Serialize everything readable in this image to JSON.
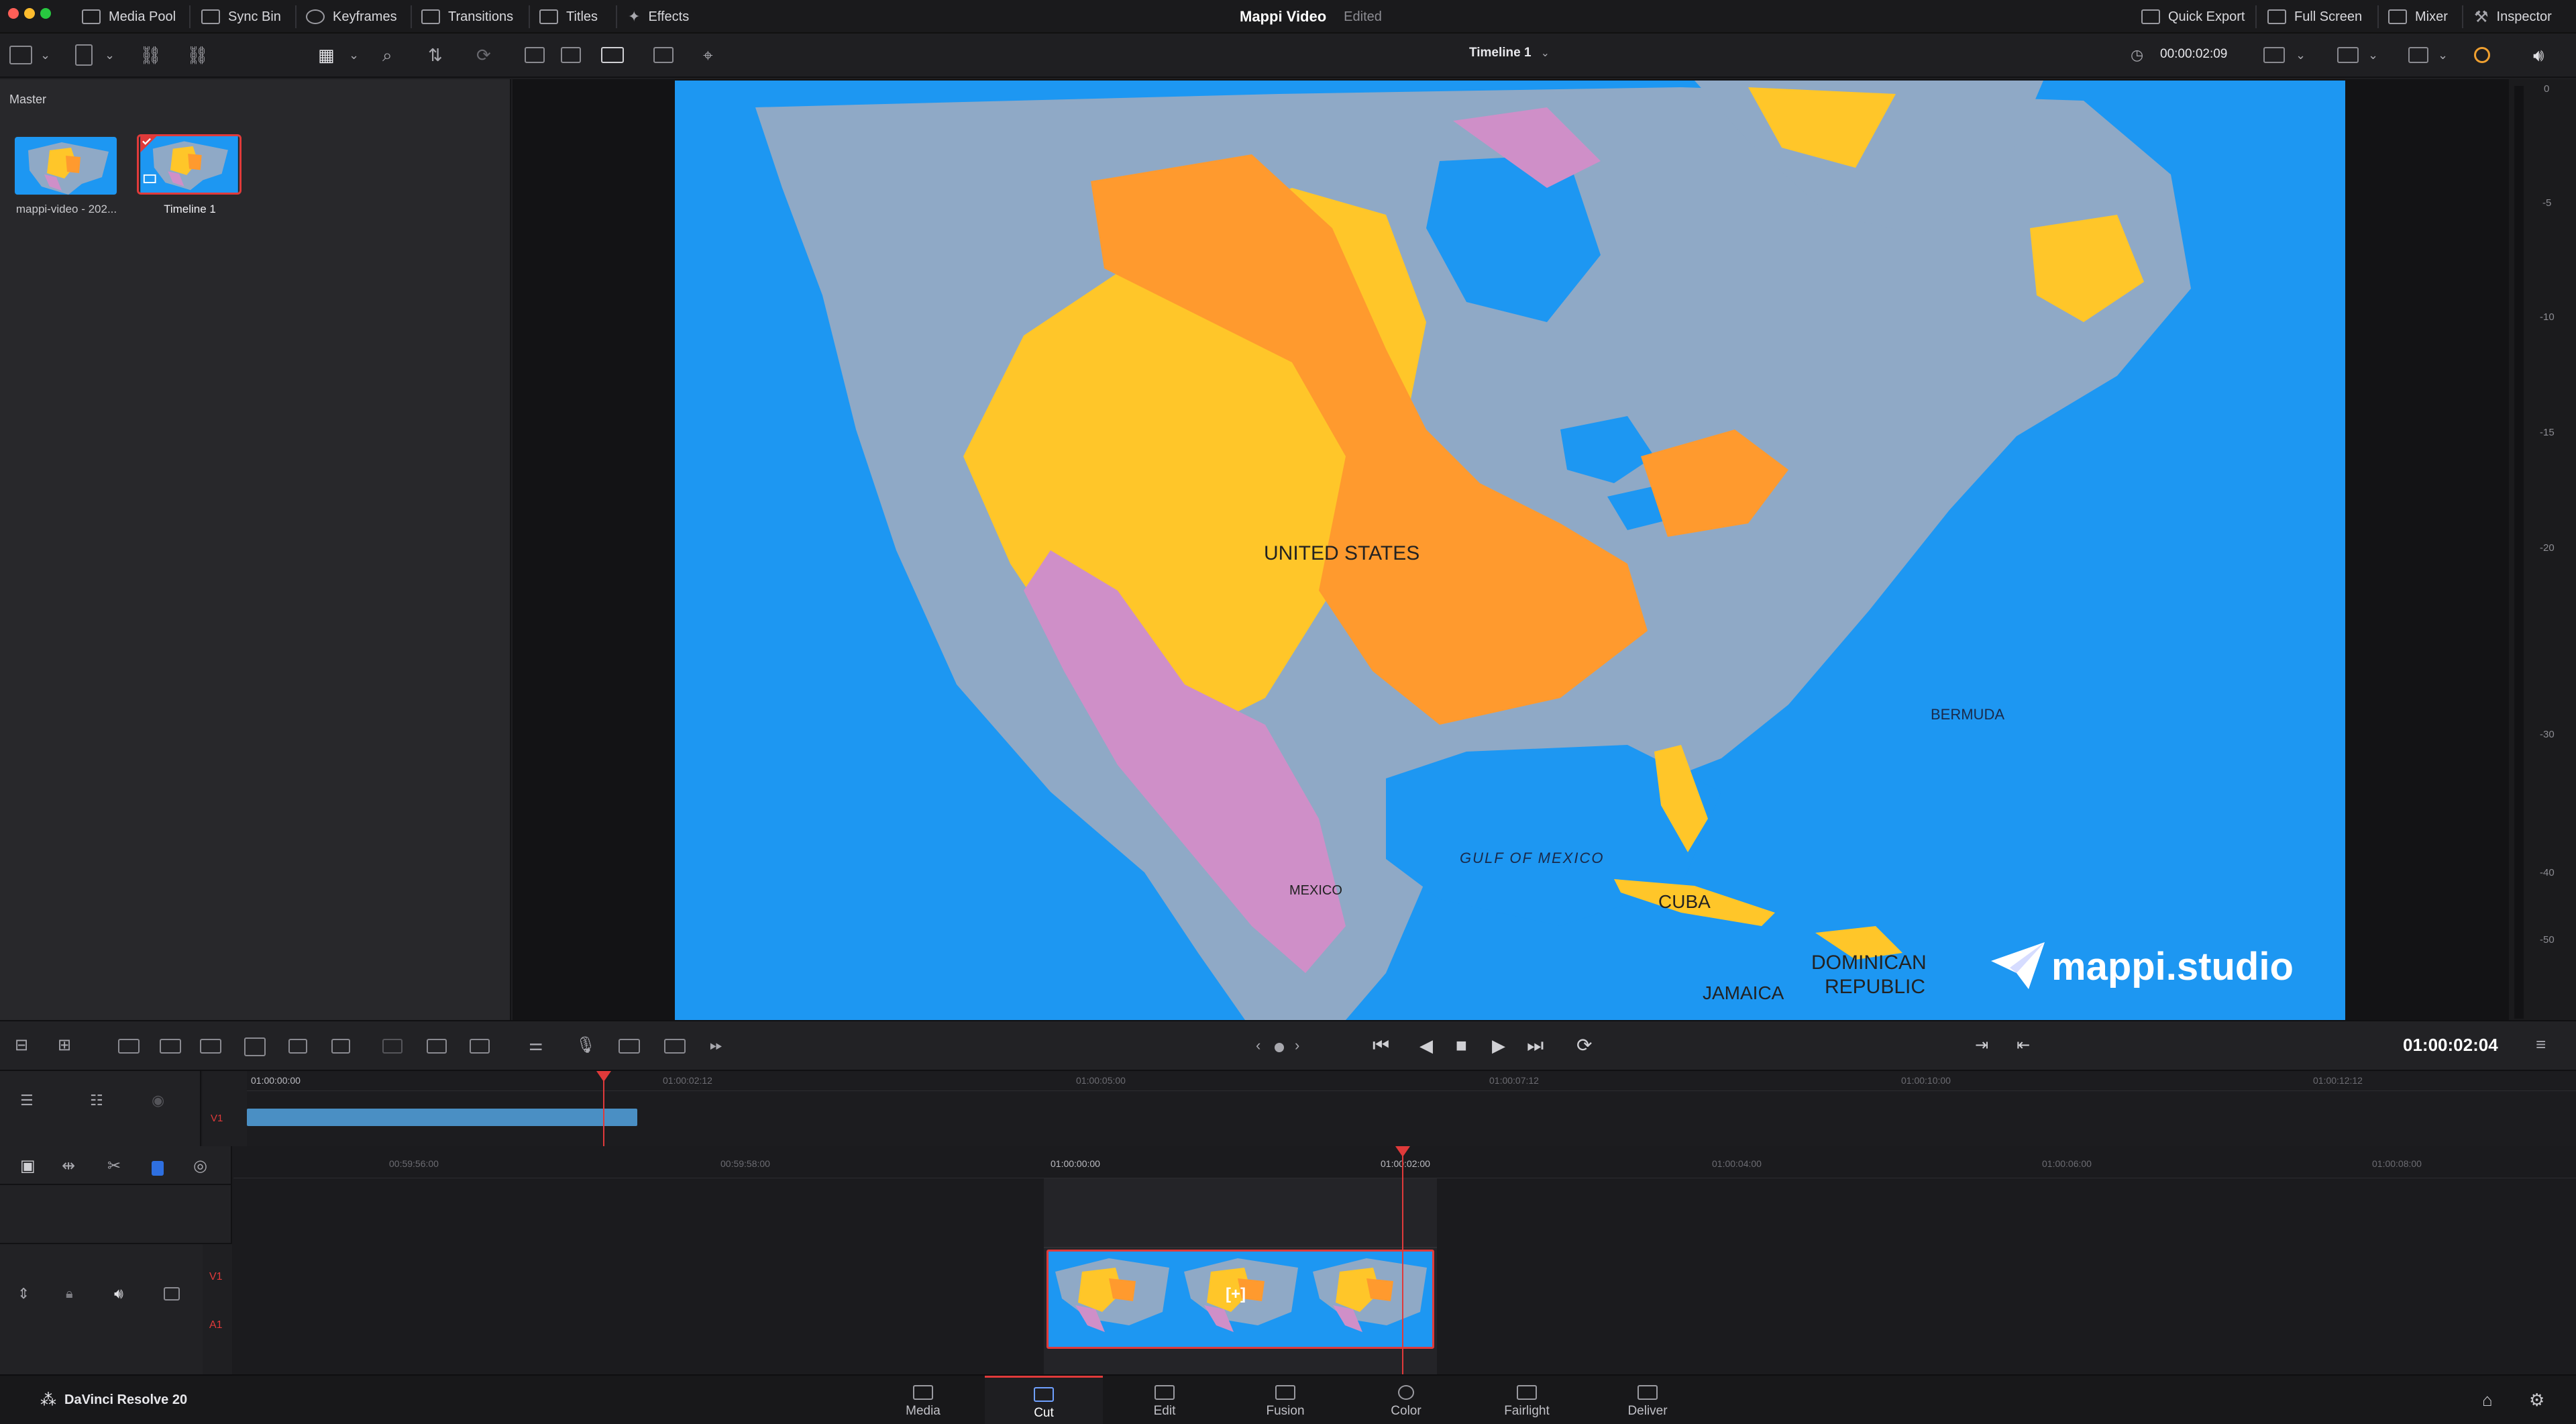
{
  "menubar": {
    "title": "Mappi Video",
    "status": "Edited",
    "left_items": [
      "Media Pool",
      "Sync Bin",
      "Keyframes",
      "Transitions",
      "Titles",
      "Effects"
    ],
    "right_items": [
      "Quick Export",
      "Full Screen",
      "Mixer",
      "Inspector"
    ]
  },
  "toolbar": {
    "timeline_name": "Timeline 1",
    "source_timecode": "00:00:02:09"
  },
  "media_pool": {
    "bin": "Master",
    "clips": [
      {
        "label": "mappi-video - 202..."
      },
      {
        "label": "Timeline 1"
      }
    ]
  },
  "viewer": {
    "labels": [
      "UNITED STATES",
      "BERMUDA",
      "GULF OF MEXICO",
      "MEXICO",
      "CUBA",
      "DOMINICAN",
      "REPUBLIC",
      "JAMAICA"
    ],
    "watermark": "mappi.studio"
  },
  "meter": {
    "ticks": [
      "0",
      "-5",
      "-10",
      "-15",
      "-20",
      "-30",
      "-40",
      "-50"
    ]
  },
  "transport": {
    "timecode": "01:00:02:04"
  },
  "upper_timeline": {
    "ruler": [
      "01:00:00:00",
      "01:00:02:12",
      "01:00:05:00",
      "01:00:07:12",
      "01:00:10:00",
      "01:00:12:12"
    ],
    "track": "V1"
  },
  "lower_timeline": {
    "ruler": [
      "00:59:56:00",
      "00:59:58:00",
      "01:00:00:00",
      "01:00:02:00",
      "01:00:04:00",
      "01:00:06:00",
      "01:00:08:00"
    ],
    "tracks": [
      "V1",
      "A1"
    ],
    "clip_marker": "[+]"
  },
  "pagenav": {
    "app": "DaVinci Resolve 20",
    "pages": [
      "Media",
      "Cut",
      "Edit",
      "Fusion",
      "Color",
      "Fairlight",
      "Deliver"
    ],
    "active": "Cut"
  },
  "colors": {
    "accent_red": "#e03a3a",
    "clip_blue": "#4a8fc4",
    "water": "#1d97f2",
    "land": "#8fa9c6",
    "orange": "#ff9a2e",
    "yellow": "#ffc629",
    "pink": "#cf8fc8"
  }
}
